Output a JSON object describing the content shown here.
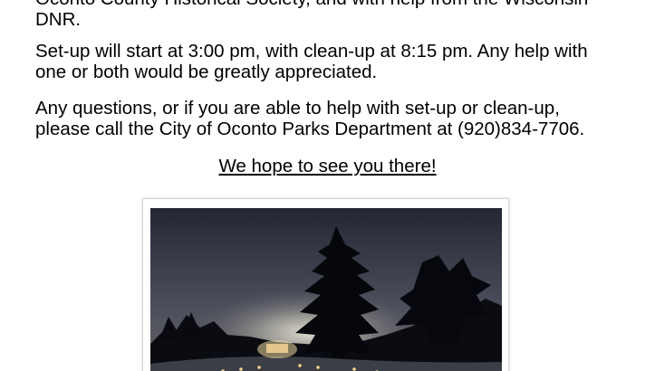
{
  "paragraphs": [
    {
      "lines": [
        "Oconto County Historical Society, and with help from the Wisconsin",
        "DNR."
      ]
    },
    {
      "lines": [
        "Set-up will start at 3:00 pm, with clean-up at 8:15 pm. Any help with",
        "one or both would be greatly appreciated."
      ]
    },
    {
      "lines": [
        "Any questions, or if you are able to help with set-up or clean-up,",
        "please call the City of Oconto Parks Department at (920)834-7706."
      ]
    }
  ],
  "closing": "We hope to see you there!",
  "photo": {
    "subject": "night-park-scene-with-luminaries",
    "colors": {
      "sky_top": "#2a2f3d",
      "sky_glow": "#c9c7bd",
      "tree": "#07080c",
      "snow": "#3a3c45",
      "lights": "#f6d28a"
    }
  }
}
